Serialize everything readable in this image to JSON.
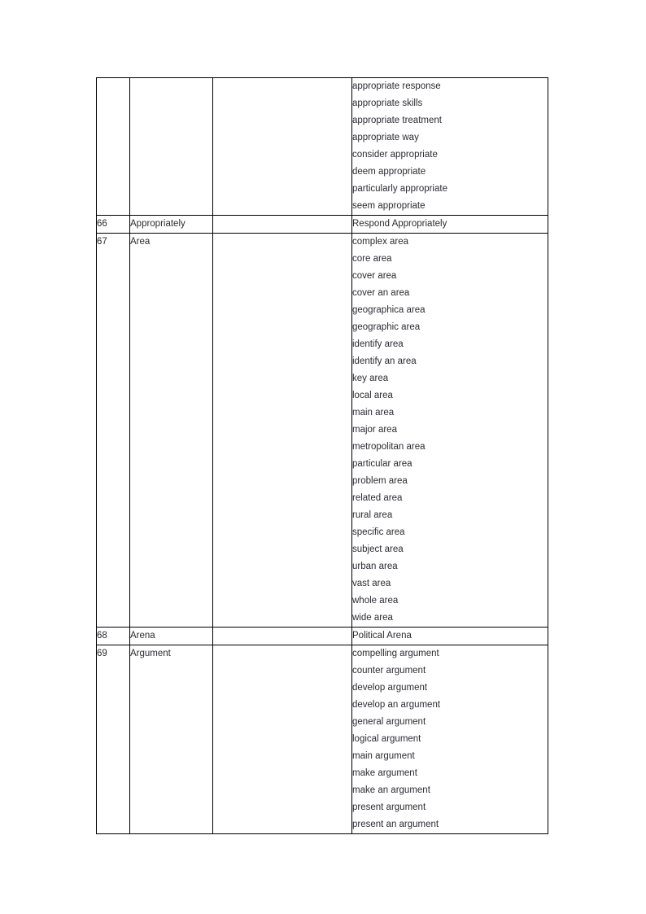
{
  "document": {
    "type": "collocation-reference-table",
    "page_background": "#ffffff",
    "text_color": "#2b2b33",
    "border_color": "#000000"
  },
  "table": {
    "columns": [
      {
        "key": "number",
        "header": ""
      },
      {
        "key": "headword",
        "header": ""
      },
      {
        "key": "middle",
        "header": ""
      },
      {
        "key": "collocations",
        "header": ""
      }
    ],
    "rows": [
      {
        "number": "",
        "headword": "",
        "middle": "",
        "collocations": [
          "appropriate response",
          "appropriate skills",
          "appropriate treatment",
          "appropriate way",
          "consider appropriate",
          "deem appropriate",
          "particularly appropriate",
          "seem appropriate"
        ]
      },
      {
        "number": "66",
        "headword": "Appropriately",
        "middle": "",
        "collocations": [
          "Respond Appropriately"
        ]
      },
      {
        "number": "67",
        "headword": "Area",
        "middle": "",
        "collocations": [
          "complex area",
          "core area",
          "cover area",
          "cover an area",
          "geographica area",
          "geographic area",
          "identify area",
          "identify an area",
          "key area",
          "local area",
          "main area",
          "major area",
          "metropolitan area",
          "particular area",
          "problem area",
          "related area",
          "rural area",
          "specific area",
          "subject area",
          "urban area",
          "vast area",
          "whole area",
          "wide area"
        ]
      },
      {
        "number": "68",
        "headword": "Arena",
        "middle": "",
        "collocations": [
          "Political Arena"
        ]
      },
      {
        "number": "69",
        "headword": "Argument",
        "middle": "",
        "collocations": [
          "compelling argument",
          "counter argument",
          "develop argument",
          "develop an argument",
          "general argument",
          "logical argument",
          "main argument",
          "make argument",
          "make an argument",
          "present argument",
          "present an argument"
        ]
      }
    ]
  }
}
